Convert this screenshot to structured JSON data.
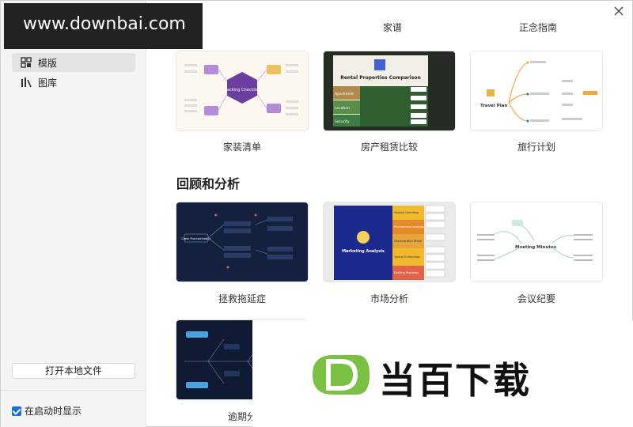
{
  "watermark_top": "www.downbai.com",
  "watermark_brand": "当百下载",
  "sidebar": {
    "items": [
      {
        "label": "模版",
        "icon": "template-icon",
        "active": true
      },
      {
        "label": "图库",
        "icon": "gallery-icon",
        "active": false
      }
    ],
    "open_local_file": "打开本地文件",
    "show_on_startup": "在启动时显示"
  },
  "top_row_labels": [
    "家谱",
    "正念指南"
  ],
  "row1": [
    {
      "label": "家装清单",
      "thumb_title": "Packing Checklist"
    },
    {
      "label": "房产租赁比较",
      "thumb_title": "Rental Properties Comparison",
      "thumb_rows": [
        "Apartment",
        "Location",
        "Security"
      ]
    },
    {
      "label": "旅行计划",
      "thumb_title": "Travel Plan"
    }
  ],
  "section_title": "回顾和分析",
  "row2": [
    {
      "label": "拯救拖延症",
      "thumb_title": "Crash Procrastination"
    },
    {
      "label": "市场分析",
      "thumb_title": "Marketing Analysis",
      "thumb_rows": [
        "Product Definition",
        "Environment Analysis",
        "Characteristics Period",
        "Typical Enterprises",
        "Existing Problems"
      ]
    },
    {
      "label": "会议纪要",
      "thumb_title": "Meeting Minutes"
    }
  ],
  "row3": [
    {
      "label": "逾期分"
    }
  ],
  "colors": {
    "accent": "#1a6fd6",
    "sidebar_bg": "#f4f4f4",
    "logo_green": "#7ac043"
  }
}
